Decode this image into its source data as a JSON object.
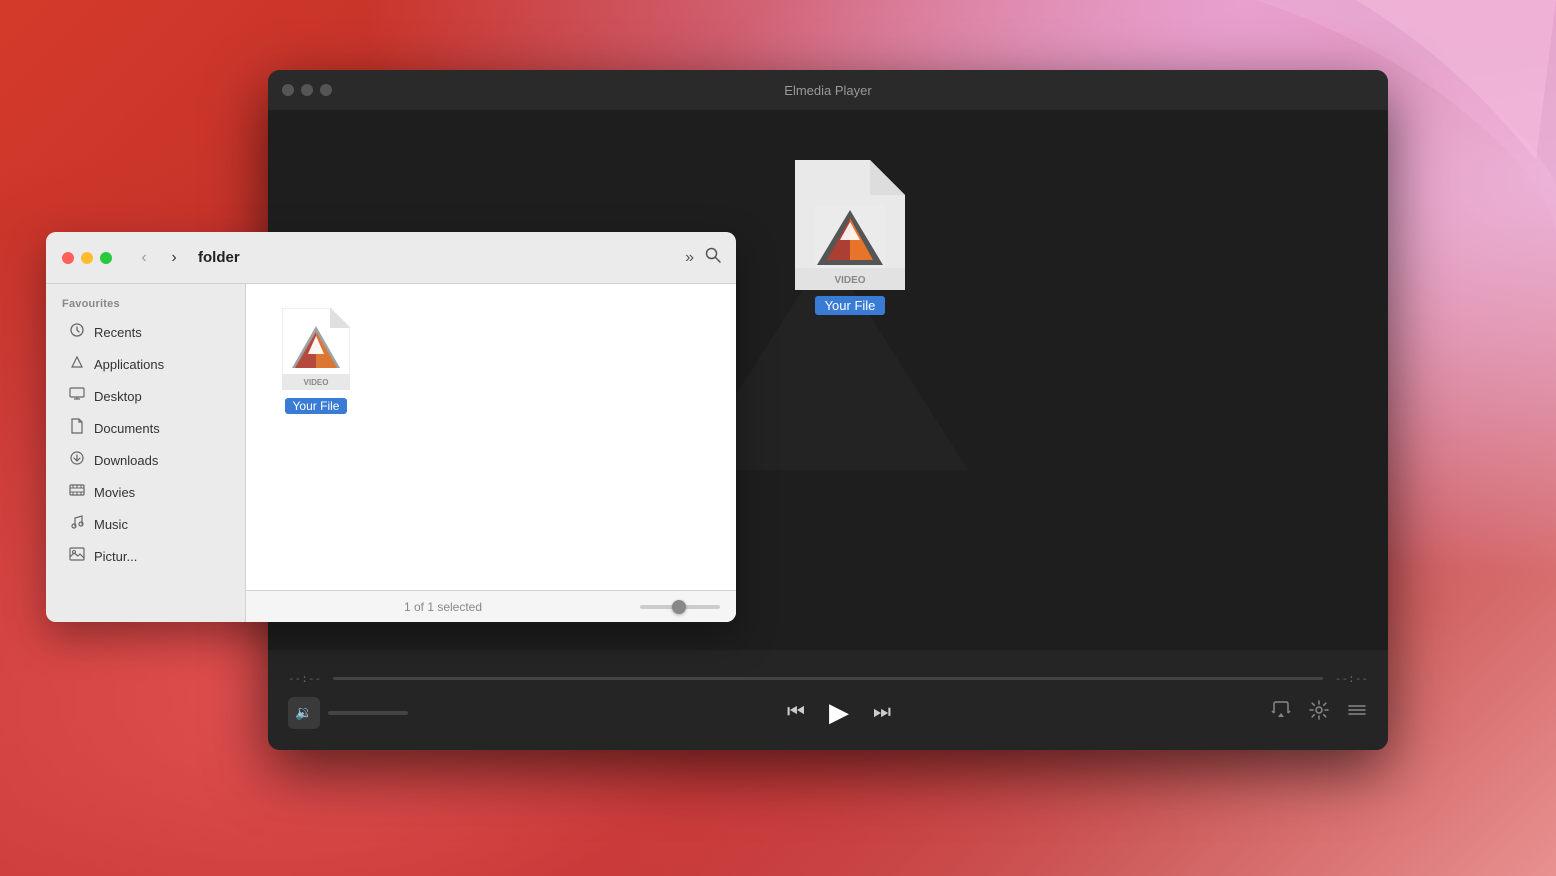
{
  "background": {
    "color1": "#c0302a",
    "color2": "#e89090"
  },
  "player": {
    "title": "Elmedia Player",
    "time_start": "--:--",
    "time_end": "--:--",
    "file_label": "Your File",
    "traffic_lights": [
      "close",
      "minimize",
      "maximize"
    ]
  },
  "finder": {
    "title": "folder",
    "traffic_lights": [
      "close",
      "minimize",
      "maximize"
    ],
    "sidebar": {
      "section_label": "Favourites",
      "items": [
        {
          "id": "recents",
          "label": "Recents",
          "icon": "⏱"
        },
        {
          "id": "applications",
          "label": "Applications",
          "icon": "🚀"
        },
        {
          "id": "desktop",
          "label": "Desktop",
          "icon": "🖥"
        },
        {
          "id": "documents",
          "label": "Documents",
          "icon": "📄"
        },
        {
          "id": "downloads",
          "label": "Downloads",
          "icon": "⬇"
        },
        {
          "id": "movies",
          "label": "Movies",
          "icon": "🎬"
        },
        {
          "id": "music",
          "label": "Music",
          "icon": "🎵"
        },
        {
          "id": "pictures",
          "label": "Pictures",
          "icon": "🖼"
        }
      ]
    },
    "status": "1 of 1 selected",
    "file": {
      "label": "Your File",
      "type": "VIDEO"
    }
  },
  "controls": {
    "skip_back": "⏮",
    "play": "▶",
    "skip_forward": "⏭",
    "airplay": "airplay",
    "settings": "settings",
    "list": "list",
    "volume": "🔉"
  }
}
